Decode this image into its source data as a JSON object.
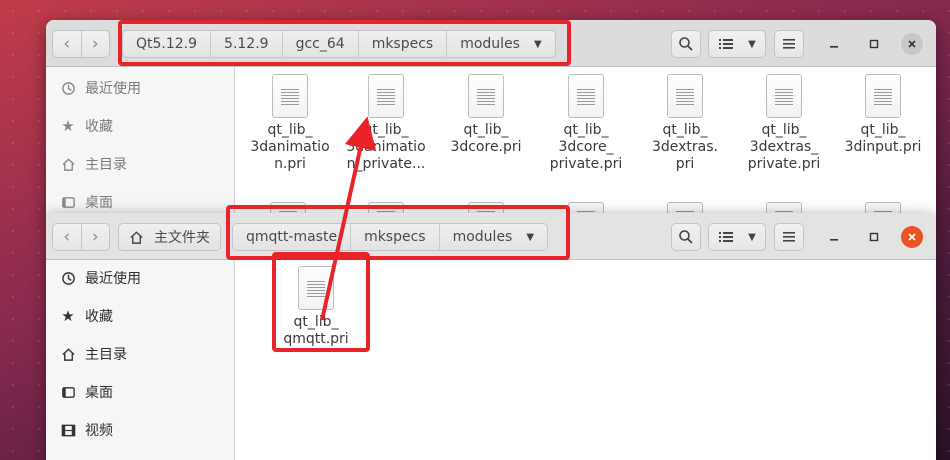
{
  "window_back": {
    "breadcrumbs": [
      "Qt5.12.9",
      "5.12.9",
      "gcc_64",
      "mkspecs",
      "modules"
    ],
    "sidebar": [
      {
        "icon": "clock-icon",
        "label": "最近使用"
      },
      {
        "icon": "star-icon",
        "label": "收藏"
      },
      {
        "icon": "home-icon",
        "label": "主目录"
      },
      {
        "icon": "desktop-icon",
        "label": "桌面"
      }
    ],
    "files": [
      {
        "name_lines": [
          "qt_lib_",
          "3danimatio",
          "n.pri"
        ]
      },
      {
        "name_lines": [
          "qt_lib_",
          "3danimatio",
          "n_private..."
        ]
      },
      {
        "name_lines": [
          "qt_lib_",
          "3dcore.pri"
        ]
      },
      {
        "name_lines": [
          "qt_lib_",
          "3dcore_",
          "private.pri"
        ]
      },
      {
        "name_lines": [
          "qt_lib_",
          "3dextras.",
          "pri"
        ]
      },
      {
        "name_lines": [
          "qt_lib_",
          "3dextras_",
          "private.pri"
        ]
      },
      {
        "name_lines": [
          "qt_lib_",
          "3dinput.pri"
        ]
      }
    ]
  },
  "window_front": {
    "home_label": "主文件夹",
    "breadcrumbs": [
      "qmqtt-maste",
      "mkspecs",
      "modules"
    ],
    "sidebar": [
      {
        "icon": "clock-icon",
        "label": "最近使用"
      },
      {
        "icon": "star-icon",
        "label": "收藏"
      },
      {
        "icon": "home-icon",
        "label": "主目录"
      },
      {
        "icon": "desktop-icon",
        "label": "桌面"
      },
      {
        "icon": "video-icon",
        "label": "视频"
      }
    ],
    "files": [
      {
        "name_lines": [
          "qt_lib_",
          "qmqtt.pri"
        ]
      }
    ]
  },
  "colors": {
    "highlight": "#e8232a",
    "close_active": "#e95420"
  }
}
